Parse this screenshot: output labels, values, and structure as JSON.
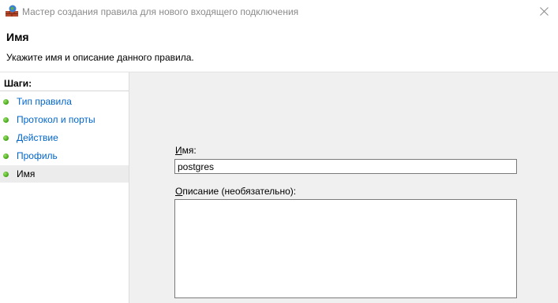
{
  "window": {
    "title": "Мастер создания правила для нового входящего подключения",
    "icon": "firewall-icon",
    "close_icon": "close-icon"
  },
  "header": {
    "heading": "Имя",
    "subtitle": "Укажите имя и описание данного правила."
  },
  "steps": {
    "heading": "Шаги:",
    "items": [
      {
        "label": "Тип правила",
        "active": false
      },
      {
        "label": "Протокол и порты",
        "active": false
      },
      {
        "label": "Действие",
        "active": false
      },
      {
        "label": "Профиль",
        "active": false
      },
      {
        "label": "Имя",
        "active": true
      }
    ]
  },
  "form": {
    "name_label_accel": "И",
    "name_label_rest": "мя:",
    "name_value": "postgres",
    "description_label_accel": "О",
    "description_label_rest": "писание (необязательно):",
    "description_value": ""
  },
  "colors": {
    "link": "#0066cc",
    "content_bg": "#f0f0f0",
    "active_step_bg": "#ececec",
    "step_dot": "#4cae1e"
  }
}
